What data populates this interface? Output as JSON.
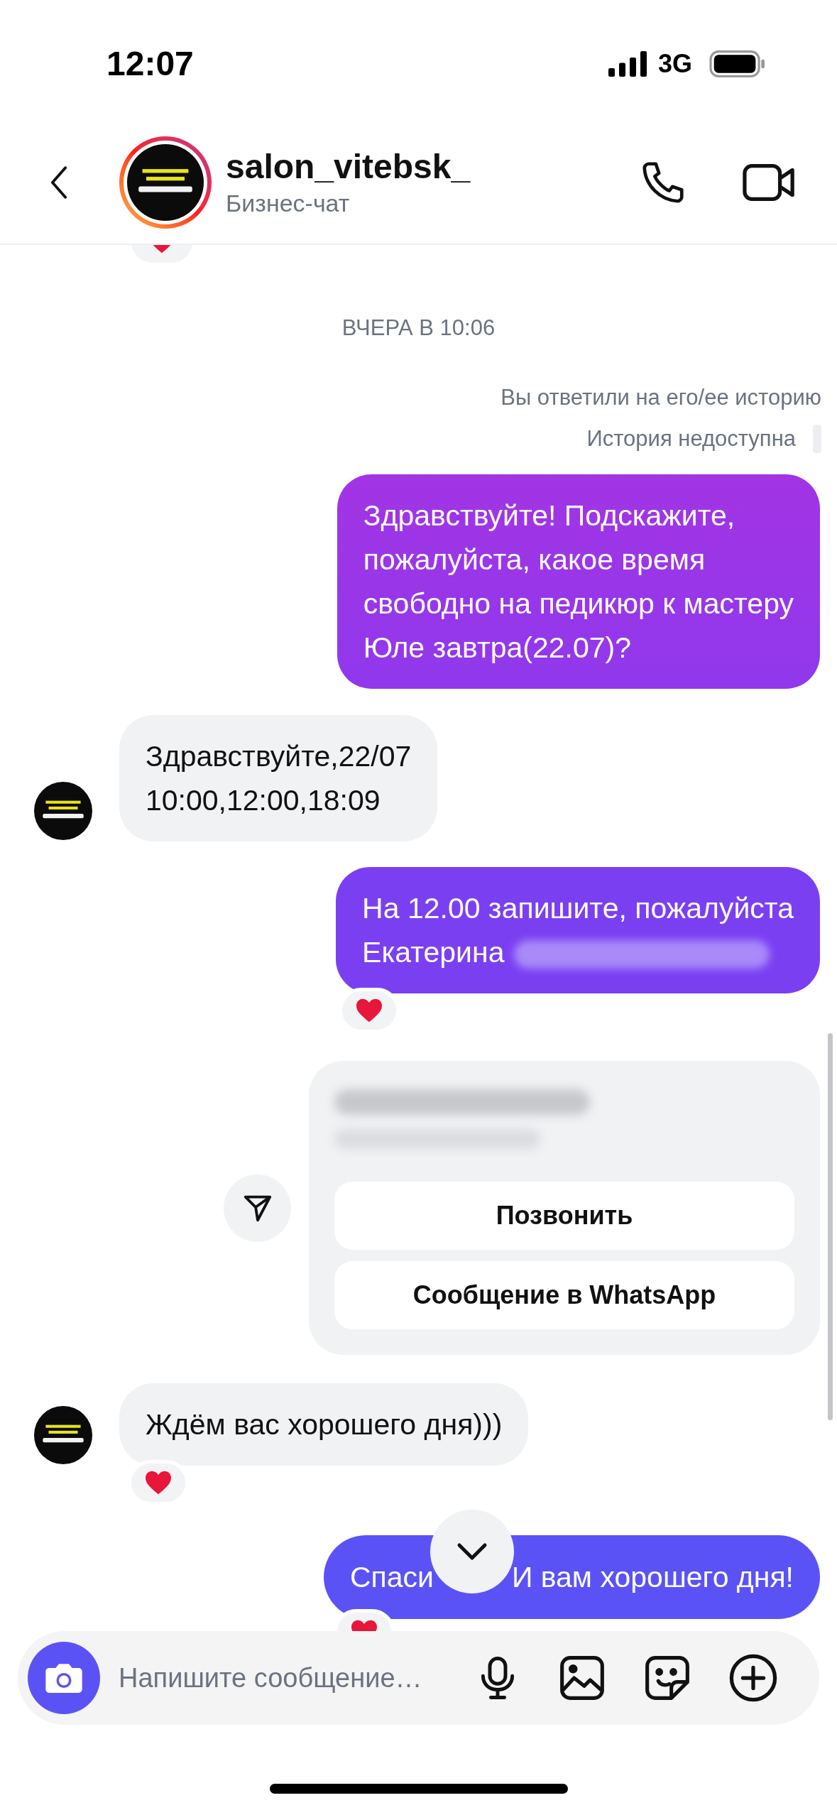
{
  "status_bar": {
    "time": "12:07",
    "network": "3G"
  },
  "header": {
    "name": "salon_vitebsk_",
    "subtitle": "Бизнес-чат"
  },
  "messages": [
    {
      "kind": "date",
      "text": "ВЧЕРА В 10:06"
    },
    {
      "kind": "note",
      "text": "Вы ответили на его/ее историю",
      "story": false
    },
    {
      "kind": "note",
      "text": "История недоступна",
      "story": true
    },
    {
      "kind": "outgoing",
      "text": "Здравствуйте! Подскажите,\nпожалуйста, какое время\nсвободно на педикюр к мастеру\nЮле завтра(22.07)?",
      "reaction": false,
      "redacted": false
    },
    {
      "kind": "incoming",
      "text": "Здравствуйте,22/07\n10:00,12:00,18:09",
      "reaction": false
    },
    {
      "kind": "outgoing",
      "text": "На 12.00 запишите, пожалуйста\nЕкатерина",
      "reaction": true,
      "redacted": true
    },
    {
      "kind": "contact",
      "buttons": [
        "Позвонить",
        "Сообщение в WhatsApp"
      ]
    },
    {
      "kind": "incoming",
      "text": "Ждём вас хорошего дня)))",
      "reaction": true
    },
    {
      "kind": "covered",
      "parts": [
        "Спаси",
        "И вам хорошего дня!"
      ],
      "reaction": true
    }
  ],
  "composer": {
    "placeholder": "Напишите сообщение…"
  }
}
